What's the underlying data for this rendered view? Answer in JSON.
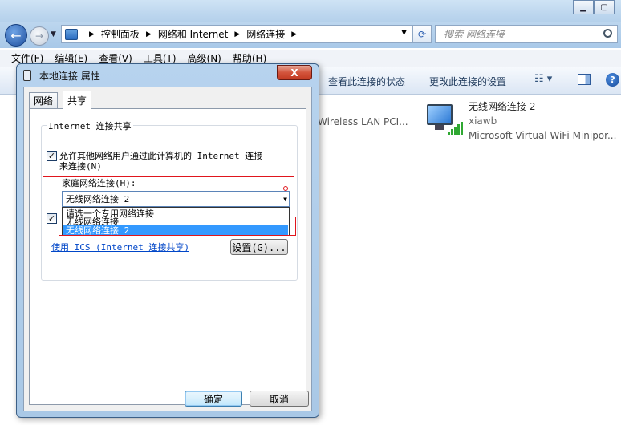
{
  "explorer": {
    "breadcrumb": [
      "控制面板",
      "网络和 Internet",
      "网络连接"
    ],
    "search_placeholder": "搜索 网络连接",
    "menu": [
      "文件(F)",
      "编辑(E)",
      "查看(V)",
      "工具(T)",
      "高级(N)",
      "帮助(H)"
    ],
    "commands": {
      "view_status": "查看此连接的状态",
      "change_settings": "更改此连接的设置"
    },
    "adapters": [
      {
        "name": "无线网络连接 2",
        "status": "xiawb",
        "description": "Microsoft Virtual WiFi Minipor..."
      }
    ],
    "partial_adapter": {
      "description": "Wireless LAN PCI..."
    }
  },
  "dialog": {
    "title": "本地连接 属性",
    "close_label": "X",
    "tabs": [
      "网络",
      "共享"
    ],
    "active_tab": "共享",
    "group_title": "Internet 连接共享",
    "allow_share_line1": "允许其他网络用户通过此计算机的 Internet 连接",
    "allow_share_line2": "来连接(N)",
    "allow_share_checked": true,
    "home_network_label": "家庭网络连接(H):",
    "home_network_selected": "无线网络连接 2",
    "dropdown_options": [
      "请选一个专用网络连接",
      "无线网络连接",
      "无线网络连接 2"
    ],
    "dropdown_selected_index": 2,
    "second_checkbox_checked": true,
    "ics_link": "使用 ICS (Internet 连接共享)",
    "settings_button": "设置(G)...",
    "ok_button": "确定",
    "cancel_button": "取消"
  }
}
